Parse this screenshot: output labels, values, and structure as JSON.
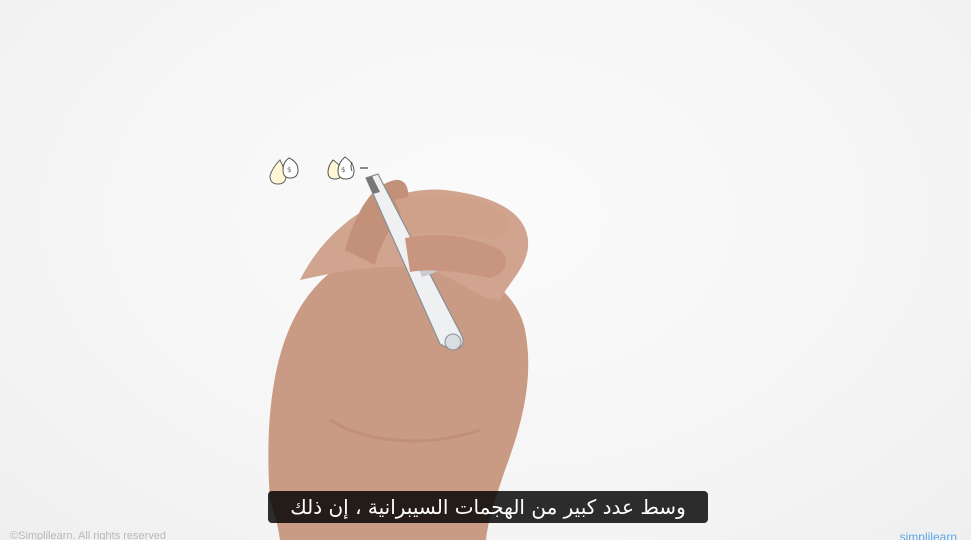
{
  "video": {
    "subtitle": "وسط عدد كبير من الهجمات السيبرانية ، إن ذلك",
    "copyright": "©Simplilearn. All rights reserved",
    "brand": "simplilearn"
  },
  "icons": {
    "left_sketch": "money-bag-icon",
    "right_sketch": "money-bags-icon"
  },
  "colors": {
    "background": "#f6f6f6",
    "subtitle_bg": "#000000",
    "brand": "#5aa6e8"
  }
}
